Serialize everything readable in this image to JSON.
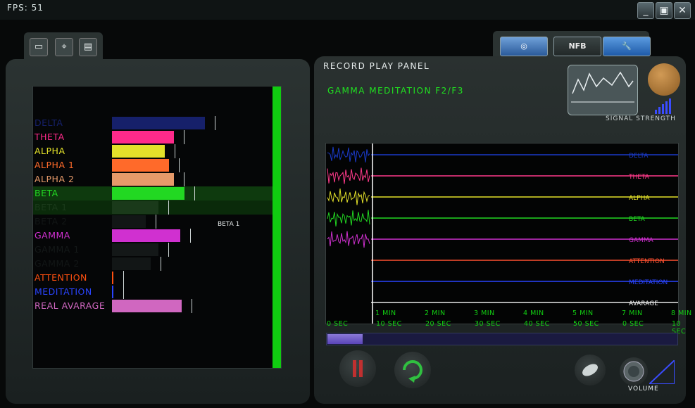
{
  "fps_text": "FPS: 51",
  "window_buttons": {
    "minimize": "_",
    "restore": "▣",
    "close": "✕"
  },
  "toolbar": {
    "icons": [
      "document-icon",
      "map-icon",
      "save-icon"
    ]
  },
  "mode_tabs": [
    "mode-visual-tab",
    "mode-nfb-tab",
    "mode-settings-tab"
  ],
  "bands": [
    {
      "name": "DELTA",
      "color": "#16206a",
      "value": 0.6
    },
    {
      "name": "THETA",
      "color": "#ff2a8a",
      "value": 0.4
    },
    {
      "name": "ALPHA",
      "color": "#e3e12a",
      "value": 0.34
    },
    {
      "name": "ALPHA 1",
      "color": "#ff6a2a",
      "value": 0.37
    },
    {
      "name": "ALPHA 2",
      "color": "#e69a6a",
      "value": 0.4
    },
    {
      "name": "BETA",
      "color": "#22d822",
      "value": 0.47
    },
    {
      "name": "BETA 1",
      "color": "#1a3a1a",
      "value": 0.3
    },
    {
      "name": "BETA 2",
      "color": "#121616",
      "value": 0.22
    },
    {
      "name": "GAMMA",
      "color": "#d030d0",
      "value": 0.44
    },
    {
      "name": "GAMMA 1",
      "color": "#141818",
      "value": 0.3
    },
    {
      "name": "GAMMA 2",
      "color": "#121616",
      "value": 0.25
    },
    {
      "name": "ATTENTION",
      "color": "#ff5010",
      "value": 0.01
    },
    {
      "name": "MEDITATION",
      "color": "#2a44ff",
      "value": 0.01
    },
    {
      "name": "REAL AVARAGE",
      "color": "#d067c0",
      "value": 0.45
    }
  ],
  "tooltip": "BETA 1",
  "record_panel": {
    "title": "RECORD PLAY PANEL",
    "session": "GAMMA MEDITATION F2/F3",
    "signal_label": "SIGNAL STRENGTH",
    "volume_label": "VOLUME"
  },
  "plot_channels": [
    {
      "name": "DELTA",
      "color": "#1a3ac8"
    },
    {
      "name": "THETA",
      "color": "#ff3a8a"
    },
    {
      "name": "ALPHA",
      "color": "#e3e12a"
    },
    {
      "name": "BETA",
      "color": "#22d822"
    },
    {
      "name": "GAMMA",
      "color": "#d030d0"
    },
    {
      "name": "ATTENTION",
      "color": "#ff5030"
    },
    {
      "name": "MEDITATION",
      "color": "#2a44ff"
    },
    {
      "name": "AVARAGE",
      "color": "#e8e8e8"
    }
  ],
  "timeline_top": [
    "1 MIN",
    "2 MIN",
    "3 MIN",
    "4 MIN",
    "5 MIN",
    "7 MIN",
    "8 MIN"
  ],
  "timeline_bottom": [
    "0 SEC",
    "10 SEC",
    "20 SEC",
    "30 SEC",
    "40 SEC",
    "50 SEC",
    "0 SEC",
    "10 SEC"
  ],
  "playback_progress": 0.1
}
